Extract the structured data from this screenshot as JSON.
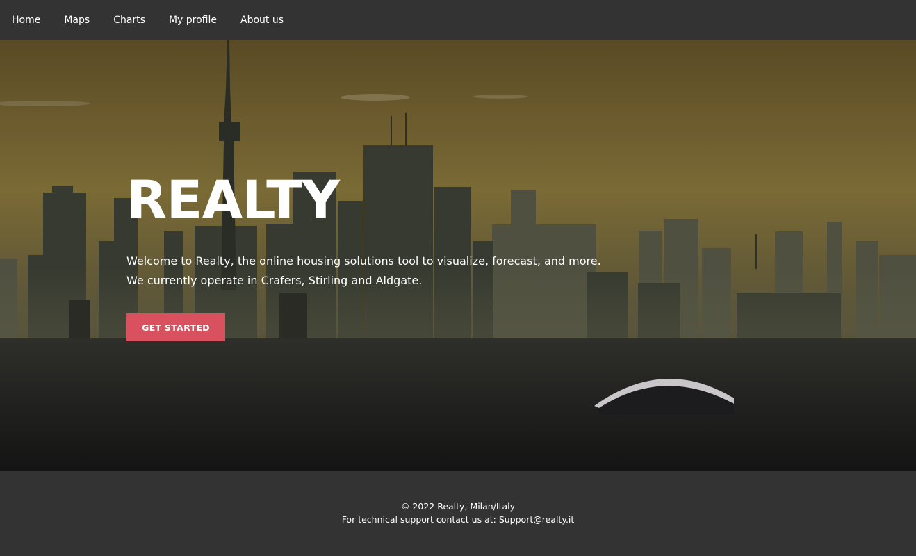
{
  "nav": {
    "items": [
      {
        "label": "Home"
      },
      {
        "label": "Maps"
      },
      {
        "label": "Charts"
      },
      {
        "label": "My profile"
      },
      {
        "label": "About us"
      }
    ]
  },
  "hero": {
    "title": "REALTY",
    "description_line1": "Welcome to Realty, the online housing solutions tool to visualize, forecast, and more.",
    "description_line2": "We currently operate in Crafers, Stirling and Aldgate.",
    "cta_label": "GET STARTED",
    "background": "city-skyline-sunset-image"
  },
  "footer": {
    "copyright": "© 2022 Realty, Milan/Italy",
    "support": "For technical support contact us at: Support@realty.it"
  },
  "colors": {
    "nav_background": "#333333",
    "footer_background": "#333333",
    "accent": "#d9505e",
    "text": "#ffffff"
  }
}
